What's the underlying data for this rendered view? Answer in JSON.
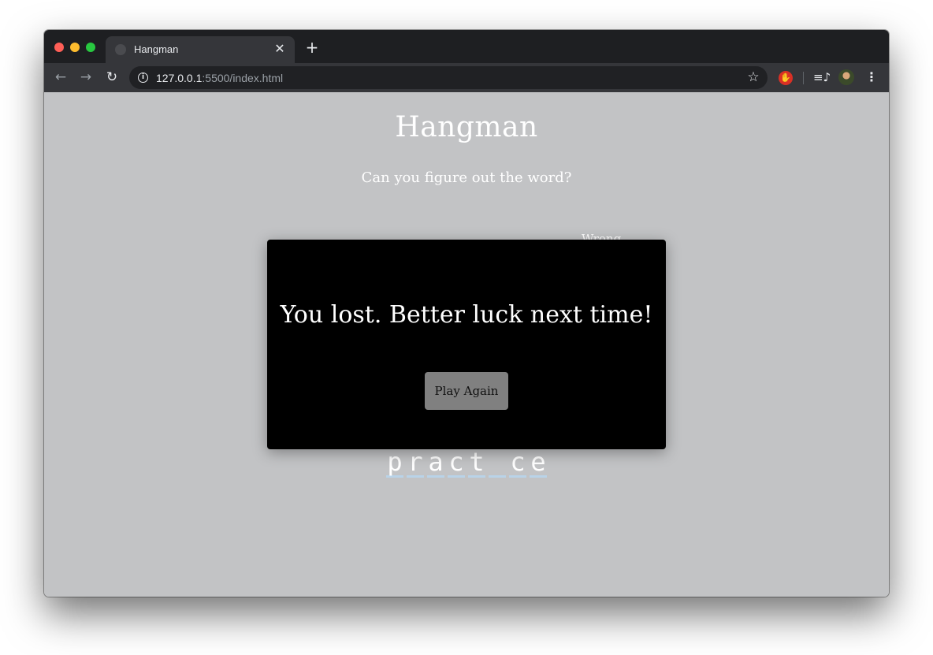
{
  "browser": {
    "tab_title": "Hangman",
    "new_tab_label": "+",
    "close_tab_label": "✕",
    "url_host": "127.0.0.1",
    "url_rest": ":5500/index.html"
  },
  "page": {
    "title": "Hangman",
    "subtitle": "Can you figure out the word?",
    "peek_text": "Wrong"
  },
  "word": {
    "letters": [
      "p",
      "r",
      "a",
      "c",
      "t",
      "",
      "c",
      "e"
    ]
  },
  "popup": {
    "message": "You lost. Better luck next time!",
    "button_label": "Play Again"
  },
  "icons": {
    "back": "arrow-left-icon",
    "forward": "arrow-right-icon",
    "reload": "reload-icon",
    "info": "info-icon",
    "star": "star-icon",
    "extension": "hand-stop-icon",
    "playlist": "playlist-icon",
    "menu": "kebab-menu-icon"
  },
  "colors": {
    "page_background": "#c2c3c5",
    "popup_background": "#000000",
    "button_background": "#808080",
    "underline": "#b9d3e8"
  }
}
